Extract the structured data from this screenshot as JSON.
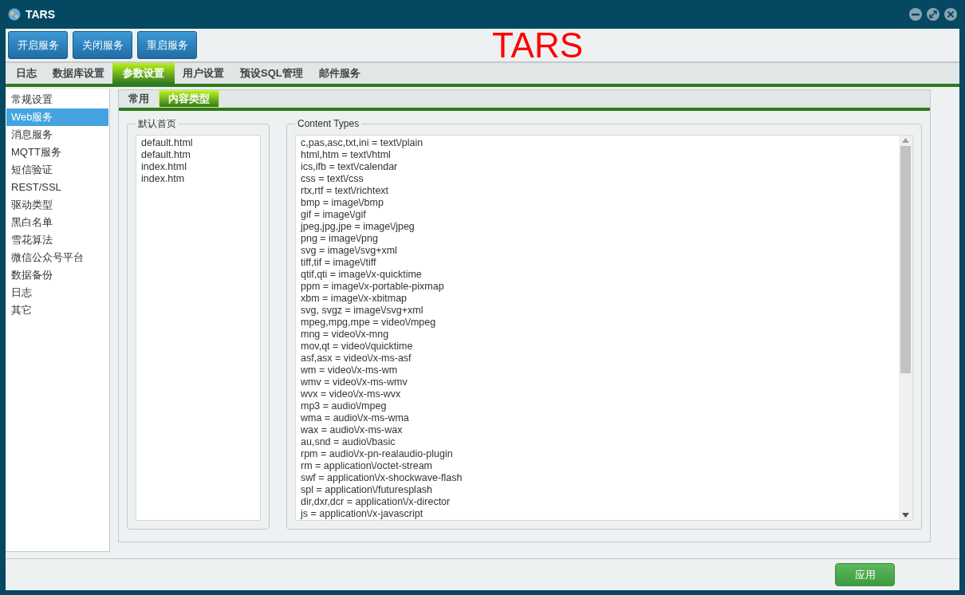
{
  "window": {
    "title": "TARS"
  },
  "toolbar": {
    "buttons": [
      "开启服务",
      "关闭服务",
      "重启服务"
    ],
    "logo": "TARS"
  },
  "tabs": [
    {
      "label": "日志",
      "selected": false
    },
    {
      "label": "数据库设置",
      "selected": false
    },
    {
      "label": "参数设置",
      "selected": true
    },
    {
      "label": "用户设置",
      "selected": false
    },
    {
      "label": "预设SQL管理",
      "selected": false
    },
    {
      "label": "邮件服务",
      "selected": false
    }
  ],
  "sidebar": {
    "items": [
      {
        "label": "常规设置",
        "selected": false
      },
      {
        "label": "Web服务",
        "selected": true
      },
      {
        "label": "消息服务",
        "selected": false
      },
      {
        "label": "MQTT服务",
        "selected": false
      },
      {
        "label": "短信验证",
        "selected": false
      },
      {
        "label": "REST/SSL",
        "selected": false
      },
      {
        "label": "驱动类型",
        "selected": false
      },
      {
        "label": "黑白名单",
        "selected": false
      },
      {
        "label": "雪花算法",
        "selected": false
      },
      {
        "label": "微信公众号平台",
        "selected": false
      },
      {
        "label": "数据备份",
        "selected": false
      },
      {
        "label": "日志",
        "selected": false
      },
      {
        "label": "其它",
        "selected": false
      }
    ]
  },
  "subtabs": [
    {
      "label": "常用",
      "selected": false
    },
    {
      "label": "内容类型",
      "selected": true
    }
  ],
  "default_pages": {
    "title": "默认首页",
    "items": [
      "default.html",
      "default.htm",
      "index.html",
      "index.htm"
    ]
  },
  "content_types": {
    "title": "Content Types",
    "lines": [
      "c,pas,asc,txt,ini = text\\/plain",
      "html,htm = text\\/html",
      "ics,ifb = text\\/calendar",
      "css = text\\/css",
      "rtx,rtf = text\\/richtext",
      "bmp = image\\/bmp",
      "gif = image\\/gif",
      "jpeg,jpg,jpe = image\\/jpeg",
      "png = image\\/png",
      "svg = image\\/svg+xml",
      "tiff,tif = image\\/tiff",
      "qtif,qti = image\\/x-quicktime",
      "ppm = image\\/x-portable-pixmap",
      "xbm = image\\/x-xbitmap",
      "svg, svgz = image\\/svg+xml",
      "mpeg,mpg,mpe = video\\/mpeg",
      "mng = video\\/x-mng",
      "mov,qt = video\\/quicktime",
      "asf,asx = video\\/x-ms-asf",
      "wm = video\\/x-ms-wm",
      "wmv = video\\/x-ms-wmv",
      "wvx = video\\/x-ms-wvx",
      "mp3 = audio\\/mpeg",
      "wma = audio\\/x-ms-wma",
      "wax = audio\\/x-ms-wax",
      "au,snd = audio\\/basic",
      "rpm = audio\\/x-pn-realaudio-plugin",
      "rm = application\\/octet-stream",
      "swf = application\\/x-shockwave-flash",
      "spl = application\\/futuresplash",
      "dir,dxr,dcr = application\\/x-director",
      "js = application\\/x-javascript"
    ]
  },
  "apply_button": "应用"
}
